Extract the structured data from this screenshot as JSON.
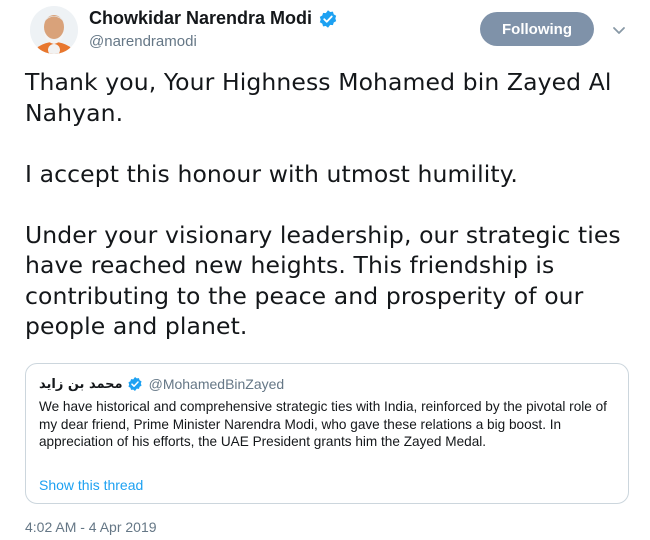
{
  "author": {
    "display_name": "Chowkidar Narendra Modi",
    "handle": "@narendramodi",
    "verified": true,
    "avatar_icon": "user-avatar"
  },
  "follow_button": {
    "label": "Following",
    "color": "#7f92a9"
  },
  "menu_icon": "chevron-down-icon",
  "tweet": {
    "paragraphs": [
      "Thank you, Your Highness Mohamed bin Zayed Al Nahyan.",
      "I accept this honour with utmost humility.",
      "Under your visionary leadership, our strategic ties have reached new heights. This friendship is contributing to the peace and prosperity of our people and planet."
    ]
  },
  "quoted_tweet": {
    "display_name": "محمد بن زايد",
    "handle": "@MohamedBinZayed",
    "verified": true,
    "text": "We have historical and comprehensive strategic ties with India, reinforced by the pivotal role of my dear friend, Prime Minister Narendra Modi, who gave these relations a big boost. In appreciation of his efforts, the UAE President grants him the Zayed Medal.",
    "show_thread_label": "Show this thread"
  },
  "timestamp": "4:02 AM - 4 Apr 2019",
  "colors": {
    "link": "#1da1f2",
    "verified": "#1da1f2",
    "secondary_text": "#657786",
    "border": "#ccd6dd"
  }
}
